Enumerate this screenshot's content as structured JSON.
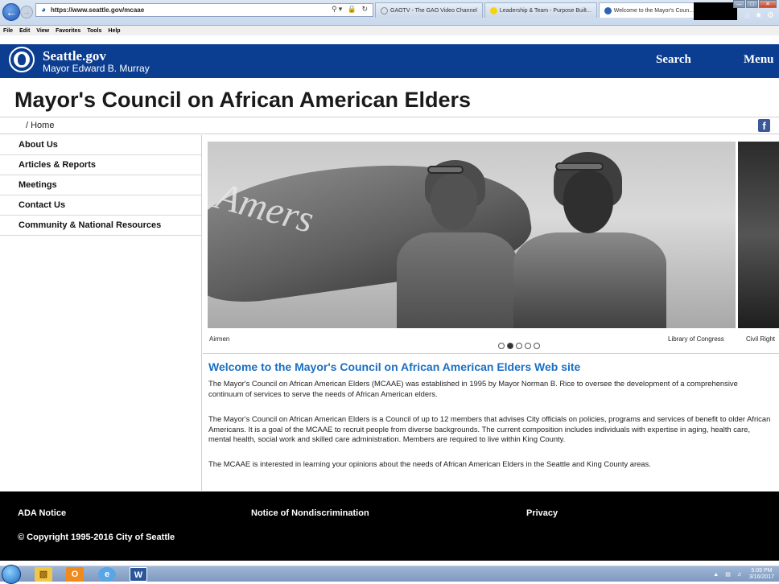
{
  "browser": {
    "url": "https://www.seattle.gov/mcaae",
    "tabs": [
      {
        "label": "GAOTV - The GAO Video Channel",
        "color": "#f4f4f4"
      },
      {
        "label": "Leadership & Team - Purpose Built...",
        "color": "#f5d40e"
      },
      {
        "label": "Welcome to the Mayor's Coun...",
        "color": "#2a63b8"
      }
    ],
    "menu": [
      "File",
      "Edit",
      "View",
      "Favorites",
      "Tools",
      "Help"
    ]
  },
  "header": {
    "site_name": "Seattle.gov",
    "mayor": "Mayor Edward B. Murray",
    "search_label": "Search",
    "menu_label": "Menu"
  },
  "page": {
    "title": "Mayor's Council on African American Elders",
    "breadcrumb": "/ Home"
  },
  "sidebar": {
    "items": [
      {
        "label": "About Us"
      },
      {
        "label": "Articles & Reports"
      },
      {
        "label": "Meetings"
      },
      {
        "label": "Contact Us"
      },
      {
        "label": "Community & National Resources"
      }
    ]
  },
  "carousel": {
    "caption_left": "Airmen",
    "caption_mid": "Library of Congress",
    "caption_right": "Civil Right",
    "active_slide": 2,
    "slide_count": 5
  },
  "content": {
    "heading": "Welcome to the Mayor's Council on African American Elders Web site",
    "paragraphs": [
      "The Mayor's Council on African American Elders (MCAAE) was established in 1995 by Mayor Norman B. Rice to oversee the development of a comprehensive continuum of services to serve the needs of African American elders.",
      "The Mayor's Council on African American Elders is a Council of up to 12 members that advises City officials on policies, programs and services of benefit to older African Americans. It is a goal of the MCAAE to recruit people from diverse backgrounds. The current composition includes individuals with expertise in aging, health care, mental health, social work and skilled care administration. Members are required to live within King County.",
      "The MCAAE is interested in learning your opinions about the needs of African American Elders in the Seattle and King County areas."
    ]
  },
  "footer": {
    "ada": "ADA Notice",
    "nondiscrimination": "Notice of Nondiscrimination",
    "privacy": "Privacy",
    "copyright": "© Copyright 1995-2016 City of Seattle"
  },
  "taskbar": {
    "time": "5:09 PM",
    "date": "3/16/2017"
  },
  "colors": {
    "header_blue": "#0b3d91",
    "heading_blue": "#1b6fc2",
    "footer_black": "#000000"
  }
}
